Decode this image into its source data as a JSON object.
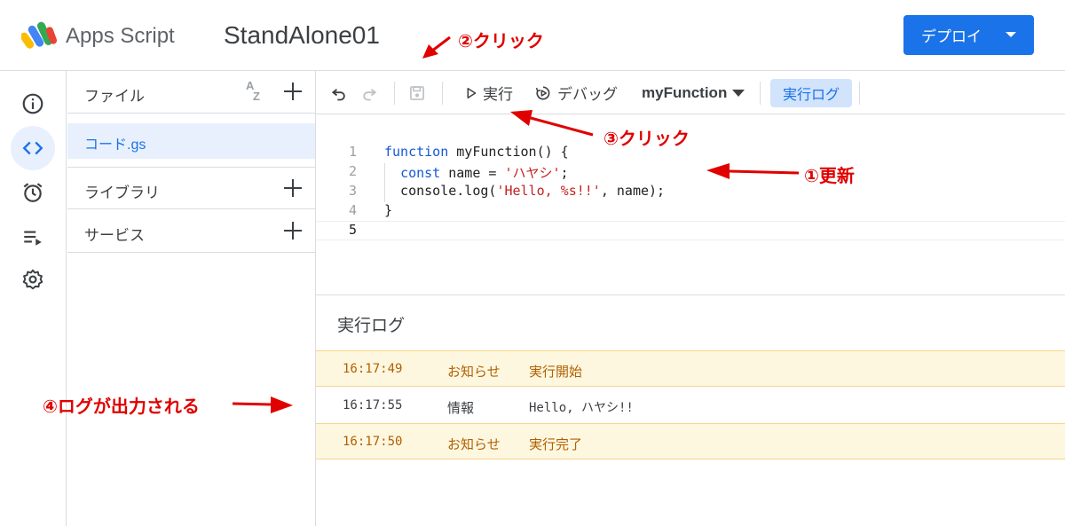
{
  "header": {
    "app_name": "Apps Script",
    "project_title": "StandAlone01",
    "deploy_label": "デプロイ",
    "brand_color": "#1a73e8"
  },
  "rail": {
    "items": [
      {
        "name": "overview",
        "icon": "info-icon"
      },
      {
        "name": "editor",
        "icon": "code-icon",
        "active": true
      },
      {
        "name": "triggers",
        "icon": "alarm-clock-icon"
      },
      {
        "name": "executions",
        "icon": "list-play-icon"
      },
      {
        "name": "settings",
        "icon": "gear-icon"
      }
    ]
  },
  "files": {
    "header_label": "ファイル",
    "sort_label_top": "A",
    "sort_label_bottom": "Z",
    "file_name": "コード.gs",
    "libraries_label": "ライブラリ",
    "services_label": "サービス"
  },
  "toolbar": {
    "run_label": "実行",
    "debug_label": "デバッグ",
    "function_name": "myFunction",
    "log_label": "実行ログ"
  },
  "editor": {
    "lines": [
      {
        "num": "1",
        "code": "function myFunction() {"
      },
      {
        "num": "2",
        "code": "  const name = 'ハヤシ';"
      },
      {
        "num": "3",
        "code": "  console.log('Hello, %s!!', name);"
      },
      {
        "num": "4",
        "code": "}"
      },
      {
        "num": "5",
        "code": ""
      }
    ],
    "line1": {
      "kw": "function",
      "rest": " myFunction() {"
    },
    "line2": {
      "indent": "  ",
      "kw": "const",
      "mid": " name = ",
      "str": "'ハヤシ'",
      "end": ";"
    },
    "line3": {
      "pre": "  console.log(",
      "str": "'Hello, %s!!'",
      "end": ", name);"
    },
    "line4": {
      "code": "}"
    }
  },
  "log": {
    "title": "実行ログ",
    "rows": [
      {
        "time": "16:17:49",
        "level": "お知らせ",
        "message": "実行開始"
      },
      {
        "time": "16:17:55",
        "level": "情報",
        "message": "Hello, ハヤシ!!"
      },
      {
        "time": "16:17:50",
        "level": "お知らせ",
        "message": "実行完了"
      }
    ]
  },
  "annotations": {
    "a1": "①更新",
    "a2": "②クリック",
    "a3": "③クリック",
    "a4": "④ログが出力される",
    "color": "#e00000"
  }
}
